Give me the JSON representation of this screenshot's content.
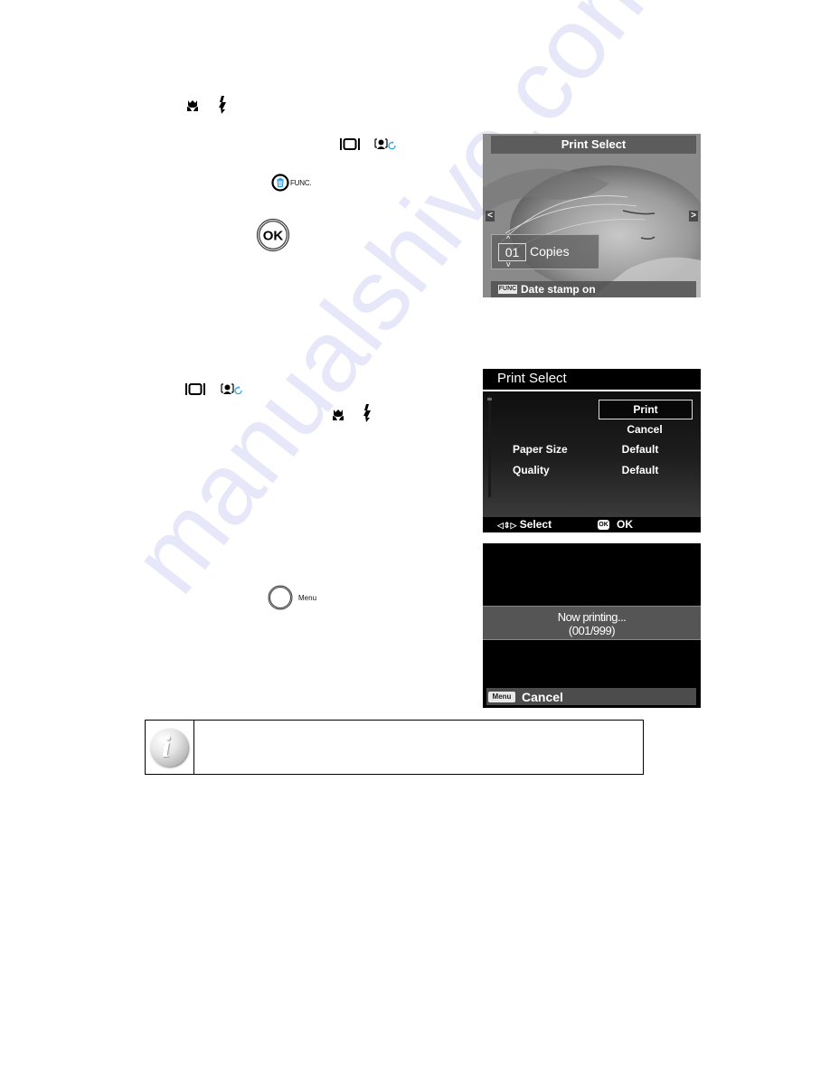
{
  "icons": {
    "macro": "macro-flower-icon",
    "flash": "flash-bolt-icon",
    "display": "display-mode-icon",
    "face_rotate": "face-detect-rotate-icon",
    "func_button": "func-trash-button-icon",
    "ok_button": "ok-button-icon",
    "menu_button": "menu-button-icon",
    "note": "info-note-icon"
  },
  "inline_labels": {
    "func": "FUNC.",
    "ok": "OK",
    "menu": "Menu"
  },
  "screen1": {
    "title": "Print Select",
    "left_arrow": "<",
    "right_arrow": ">",
    "copies_value": "01",
    "copies_label": "Copies",
    "up_arrow": "^",
    "down_arrow": "v",
    "func_badge": "FUNC",
    "footer_text": "Date stamp on"
  },
  "screen2": {
    "title": "Print Select",
    "options": [
      "Print",
      "Cancel"
    ],
    "selected_option": "Print",
    "settings": [
      {
        "label": "Paper Size",
        "value": "Default"
      },
      {
        "label": "Quality",
        "value": "Default"
      }
    ],
    "footer": {
      "nav_symbol": "◁⇕▷",
      "select_label": "Select",
      "ok_badge": "OK",
      "ok_label": "OK"
    }
  },
  "screen3": {
    "status_line1": "Now printing...",
    "status_line2": "(001/999)",
    "menu_badge": "Menu",
    "cancel_label": "Cancel"
  },
  "note": {
    "text": ""
  },
  "watermark": "manualshive.com"
}
